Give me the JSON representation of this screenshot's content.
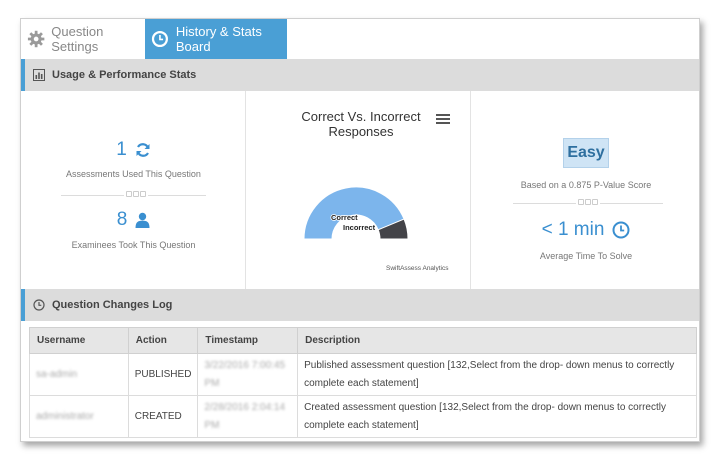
{
  "tabs": {
    "settings": "Question Settings",
    "history": "History & Stats Board"
  },
  "usage_section": {
    "title": "Usage & Performance Stats"
  },
  "stats": {
    "assessments_count": "1",
    "assessments_label": "Assessments Used This Question",
    "examinees_count": "8",
    "examinees_label": "Examinees Took This Question"
  },
  "chart": {
    "title": "Correct Vs. Incorrect Responses",
    "credits": "SwiftAssess Analytics"
  },
  "chart_data": {
    "type": "pie",
    "title": "Correct Vs. Incorrect Responses",
    "series": [
      {
        "name": "Correct",
        "value": 0.875,
        "color": "#7cb5ec"
      },
      {
        "name": "Incorrect",
        "value": 0.125,
        "color": "#434348"
      }
    ],
    "labels": [
      "Correct",
      "Incorrect"
    ]
  },
  "difficulty": {
    "badge": "Easy",
    "basis": "Based on a 0.875 P-Value Score",
    "time": "< 1 min",
    "time_label": "Average Time To Solve"
  },
  "log_section": {
    "title": "Question Changes Log"
  },
  "log_table": {
    "headers": [
      "Username",
      "Action",
      "Timestamp",
      "Description"
    ],
    "rows": [
      {
        "username": "sa-admin",
        "action": "PUBLISHED",
        "timestamp": "3/22/2016 7:00:45 PM",
        "description": "Published assessment question [132,Select from the drop- down menus to correctly complete each statement]"
      },
      {
        "username": "administrator",
        "action": "CREATED",
        "timestamp": "2/28/2016 2:04:14 PM",
        "description": "Created assessment question [132,Select from the drop- down menus to correctly complete each statement]"
      }
    ]
  }
}
